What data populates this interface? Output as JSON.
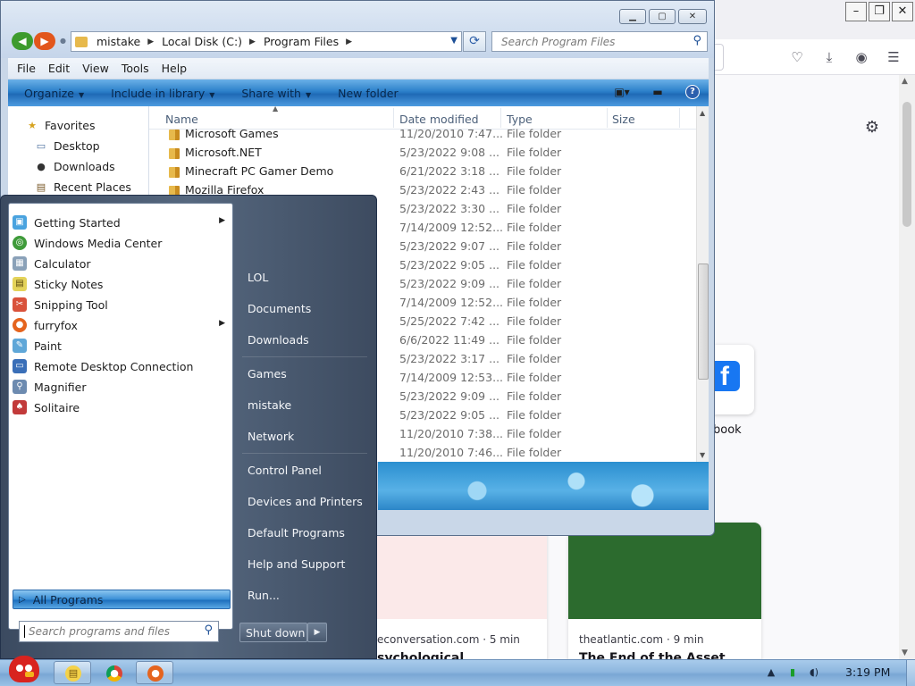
{
  "explorer": {
    "address": {
      "crumbs": [
        "mistake",
        "Local Disk (C:)",
        "Program Files"
      ]
    },
    "search_placeholder": "Search Program Files",
    "menu": [
      "File",
      "Edit",
      "View",
      "Tools",
      "Help"
    ],
    "commands": {
      "organize": "Organize",
      "include": "Include in library",
      "share": "Share with",
      "new_folder": "New folder"
    },
    "nav": {
      "favorites": "Favorites",
      "desktop": "Desktop",
      "downloads": "Downloads",
      "recent": "Recent Places"
    },
    "columns": {
      "name": "Name",
      "date": "Date modified",
      "type": "Type",
      "size": "Size"
    },
    "rows": [
      {
        "name": "Microsoft Games",
        "date": "11/20/2010 7:47...",
        "type": "File folder"
      },
      {
        "name": "Microsoft.NET",
        "date": "5/23/2022 9:08 ...",
        "type": "File folder"
      },
      {
        "name": "Minecraft PC Gamer Demo",
        "date": "6/21/2022 3:18 ...",
        "type": "File folder"
      },
      {
        "name": "Mozilla Firefox",
        "date": "5/23/2022 2:43 ...",
        "type": "File folder"
      },
      {
        "name": "",
        "date": "5/23/2022 3:30 ...",
        "type": "File folder"
      },
      {
        "name": "",
        "date": "7/14/2009 12:52...",
        "type": "File folder"
      },
      {
        "name": "",
        "date": "5/23/2022 9:07 ...",
        "type": "File folder"
      },
      {
        "name": "",
        "date": "5/23/2022 9:05 ...",
        "type": "File folder"
      },
      {
        "name": "",
        "date": "5/23/2022 9:09 ...",
        "type": "File folder"
      },
      {
        "name": "",
        "date": "7/14/2009 12:52...",
        "type": "File folder"
      },
      {
        "name": "",
        "date": "5/25/2022 7:42 ...",
        "type": "File folder"
      },
      {
        "name": "",
        "date": "6/6/2022 11:49 ...",
        "type": "File folder"
      },
      {
        "name": "",
        "date": "5/23/2022 3:17 ...",
        "type": "File folder"
      },
      {
        "name": "",
        "date": "7/14/2009 12:53...",
        "type": "File folder"
      },
      {
        "name": "",
        "date": "5/23/2022 9:09 ...",
        "type": "File folder"
      },
      {
        "name": "",
        "date": "5/23/2022 9:05 ...",
        "type": "File folder"
      },
      {
        "name": "",
        "date": "11/20/2010 7:38...",
        "type": "File folder"
      },
      {
        "name": "",
        "date": "11/20/2010 7:46...",
        "type": "File folder"
      }
    ]
  },
  "startmenu": {
    "programs": [
      {
        "label": "Getting Started",
        "icon": "getting-started-icon",
        "color": "#4aa3df",
        "submenu": true
      },
      {
        "label": "Windows Media Center",
        "icon": "media-center-icon",
        "color": "#3f9b3a",
        "submenu": false
      },
      {
        "label": "Calculator",
        "icon": "calculator-icon",
        "color": "#8aa1b8",
        "submenu": false
      },
      {
        "label": "Sticky Notes",
        "icon": "sticky-notes-icon",
        "color": "#e4d35a",
        "submenu": false
      },
      {
        "label": "Snipping Tool",
        "icon": "snipping-tool-icon",
        "color": "#d9523b",
        "submenu": false
      },
      {
        "label": "furryfox",
        "icon": "firefox-icon",
        "color": "#e5641e",
        "submenu": true
      },
      {
        "label": "Paint",
        "icon": "paint-icon",
        "color": "#5fa7d8",
        "submenu": false
      },
      {
        "label": "Remote Desktop Connection",
        "icon": "remote-desktop-icon",
        "color": "#3a6fb8",
        "submenu": false
      },
      {
        "label": "Magnifier",
        "icon": "magnifier-icon",
        "color": "#6d8bb0",
        "submenu": false
      },
      {
        "label": "Solitaire",
        "icon": "solitaire-icon",
        "color": "#c23a3a",
        "submenu": false
      }
    ],
    "all_programs": "All Programs",
    "search_placeholder": "Search programs and files",
    "places": [
      "LOL",
      "Documents",
      "Downloads",
      "Games",
      "mistake",
      "Network",
      "Control Panel",
      "Devices and Printers",
      "Default Programs",
      "Help and Support",
      "Run..."
    ],
    "shutdown": "Shut down"
  },
  "browser": {
    "tile_label": "ebook",
    "stories": [
      {
        "source": "econversation.com · 5 min",
        "headline": "sychological"
      },
      {
        "source": "theatlantic.com · 9 min",
        "headline": "The End of the Asset"
      }
    ]
  },
  "taskbar": {
    "clock": "3:19 PM"
  }
}
